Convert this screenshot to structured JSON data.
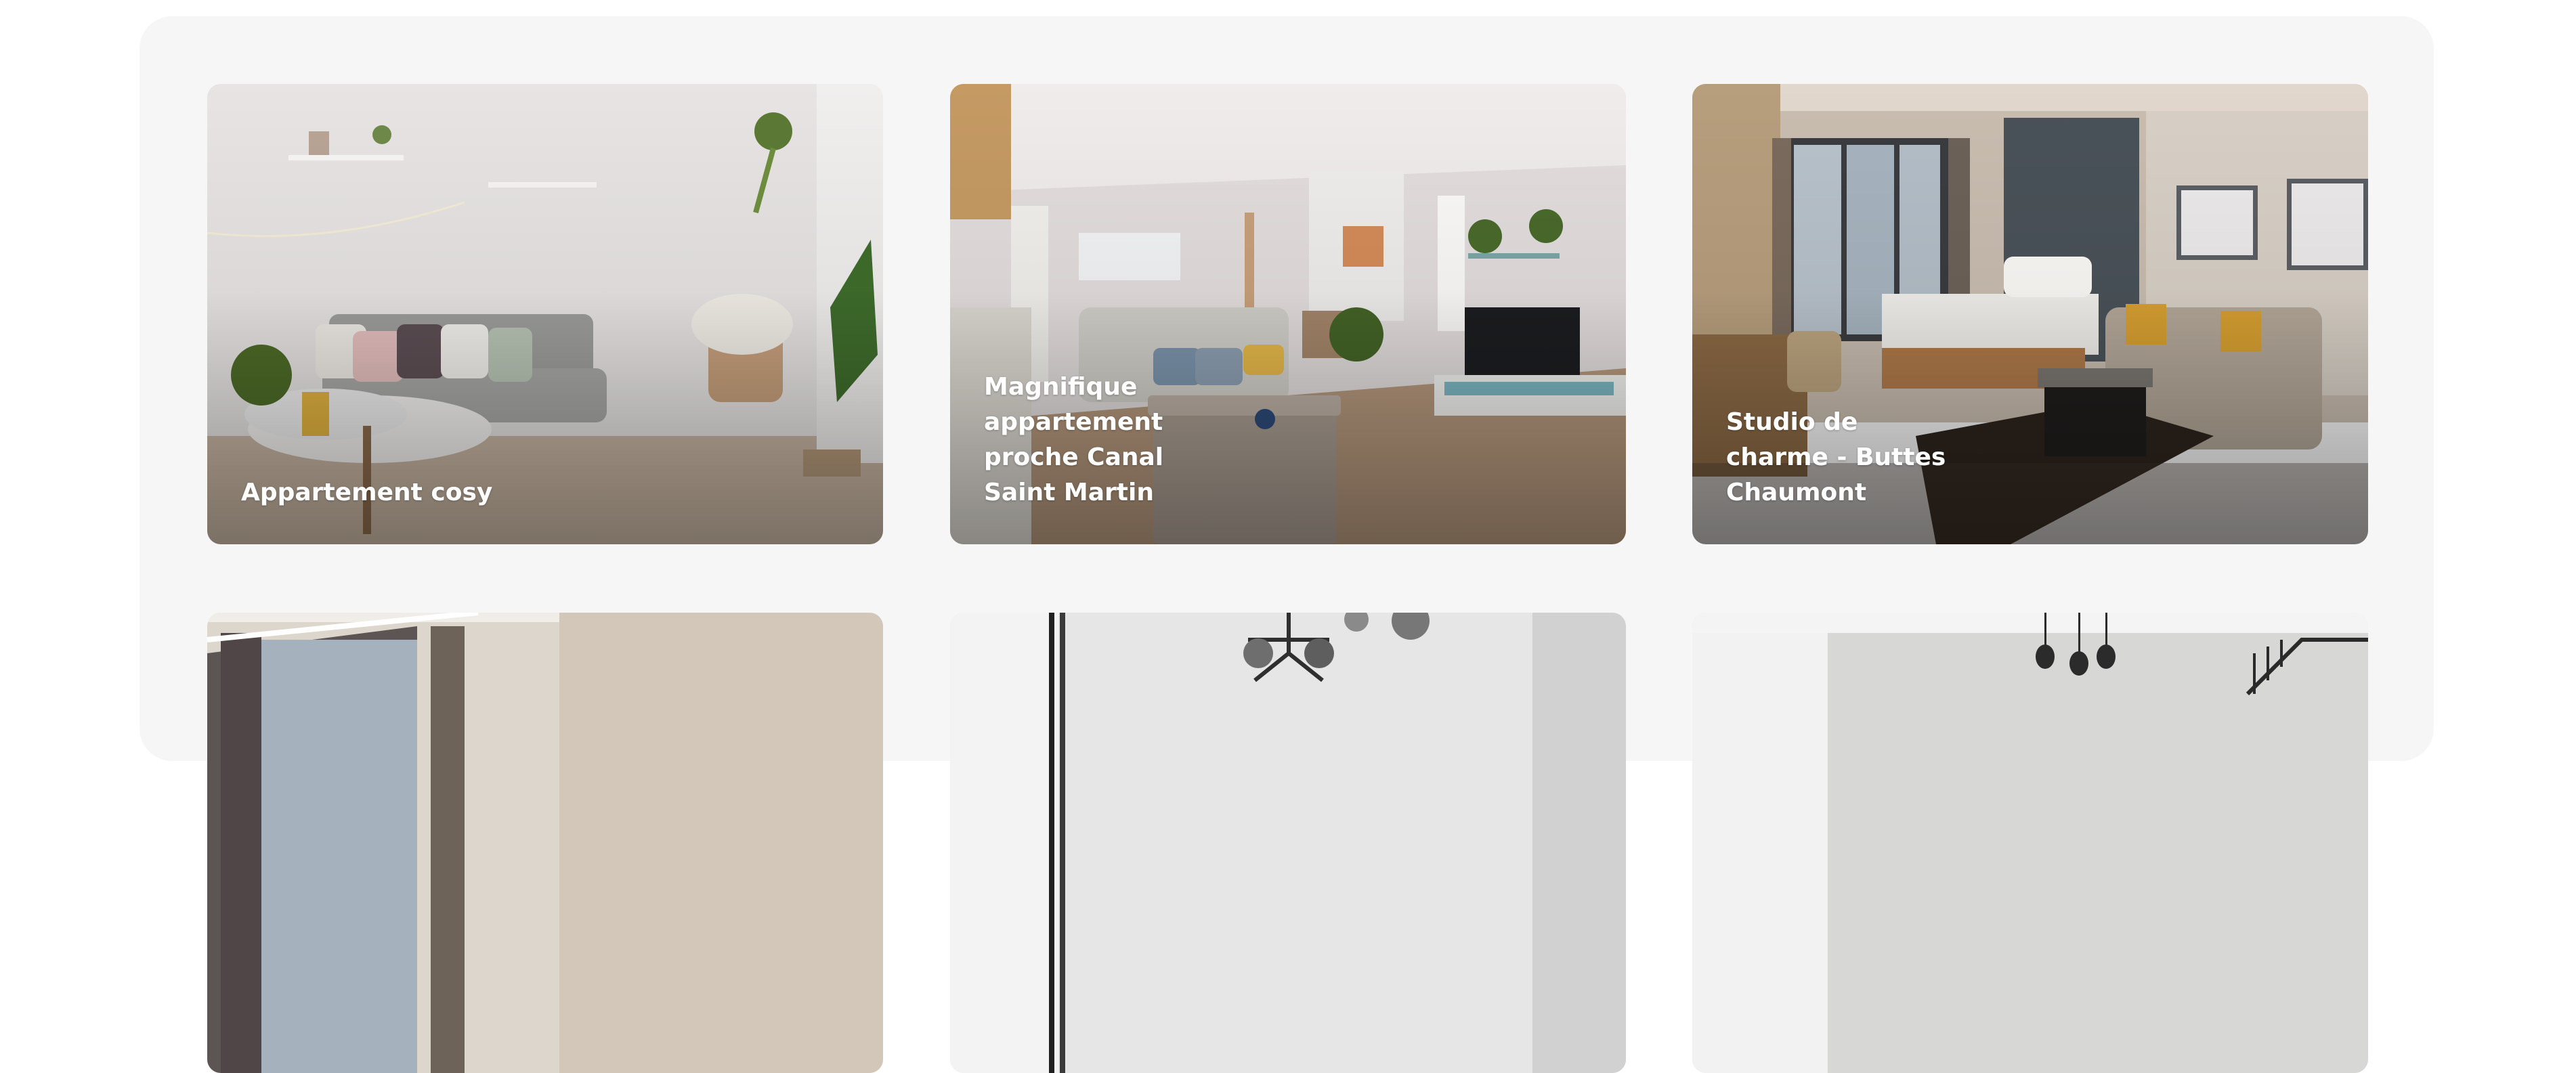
{
  "listings": [
    {
      "title": "Appartement cosy",
      "image_icon": "living-room-photo"
    },
    {
      "title": "Magnifique appartement proche Canal Saint Martin",
      "image_icon": "living-room-photo"
    },
    {
      "title": "Studio de charme - Buttes Chaumont",
      "image_icon": "bedroom-photo"
    },
    {
      "title": "",
      "image_icon": "bedroom-photo"
    },
    {
      "title": "",
      "image_icon": "dining-room-photo"
    },
    {
      "title": "",
      "image_icon": "loft-photo"
    }
  ],
  "colors": {
    "panel_background": "#f6f6f6",
    "title_text": "#ffffff"
  }
}
